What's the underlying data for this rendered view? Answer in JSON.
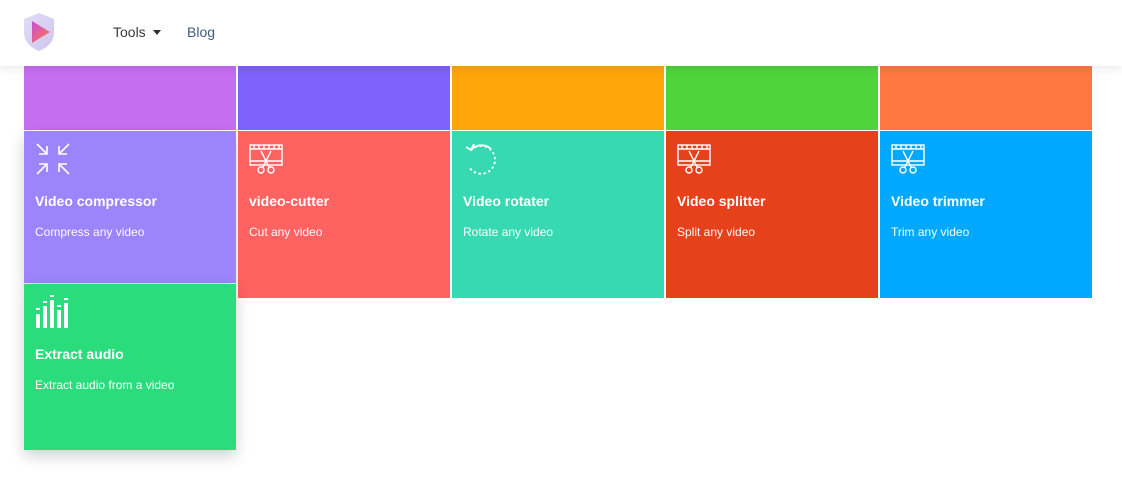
{
  "nav": {
    "tools_label": "Tools",
    "blog_label": "Blog"
  },
  "colors": {
    "row0": [
      "#c66ef0",
      "#7f62fb",
      "#fea60a",
      "#50d43c",
      "#ff7842"
    ],
    "compressor": "#9c84fc",
    "cutter": "#fe6261",
    "rotater": "#36d9b2",
    "splitter": "#e5411a",
    "trimmer": "#00a9fd",
    "extract": "#2adc7c"
  },
  "tiles": [
    {
      "title": "Video compressor",
      "desc": "Compress any video",
      "icon": "compress-arrows-icon"
    },
    {
      "title": "video-cutter",
      "desc": "Cut any video",
      "icon": "film-scissors-icon"
    },
    {
      "title": "Video rotater",
      "desc": "Rotate any video",
      "icon": "rotate-icon"
    },
    {
      "title": "Video splitter",
      "desc": "Split any video",
      "icon": "film-scissors-icon"
    },
    {
      "title": "Video trimmer",
      "desc": "Trim any video",
      "icon": "film-scissors-icon"
    },
    {
      "title": "Extract audio",
      "desc": "Extract audio from a video",
      "icon": "audio-bars-icon"
    }
  ]
}
